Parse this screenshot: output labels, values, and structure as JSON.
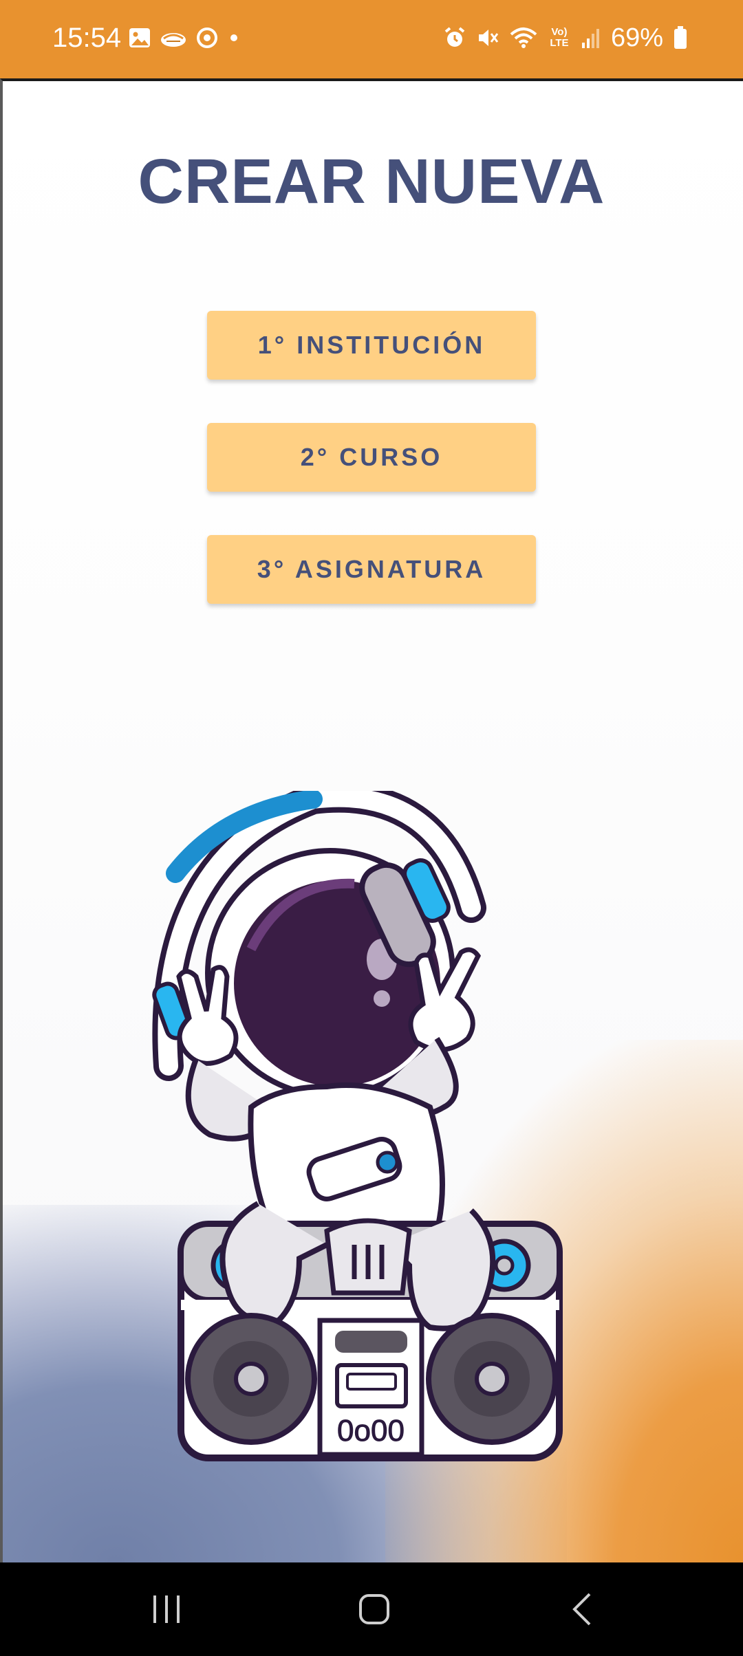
{
  "status_bar": {
    "time": "15:54",
    "battery": "69%",
    "left_icons": [
      "image-icon",
      "handshake-icon",
      "circle-sync-icon",
      "dot-icon"
    ],
    "right_icons": [
      "alarm-icon",
      "mute-icon",
      "wifi-icon",
      "volte-icon",
      "signal-icon",
      "battery-icon"
    ],
    "volte_label": "Vo) LTE",
    "color": "#e8922f"
  },
  "page": {
    "title": "CREAR NUEVA",
    "title_color": "#45507a",
    "button_color": "#ffd084"
  },
  "buttons": [
    {
      "label": "1° INSTITUCIÓN"
    },
    {
      "label": "2° CURSO"
    },
    {
      "label": "3° ASIGNATURA"
    }
  ],
  "illustration": {
    "subject": "astronaut-dj-icon",
    "boombox_digits": "0o00"
  },
  "nav_bar": {
    "items": [
      "recent-apps-icon",
      "home-icon",
      "back-icon"
    ]
  }
}
